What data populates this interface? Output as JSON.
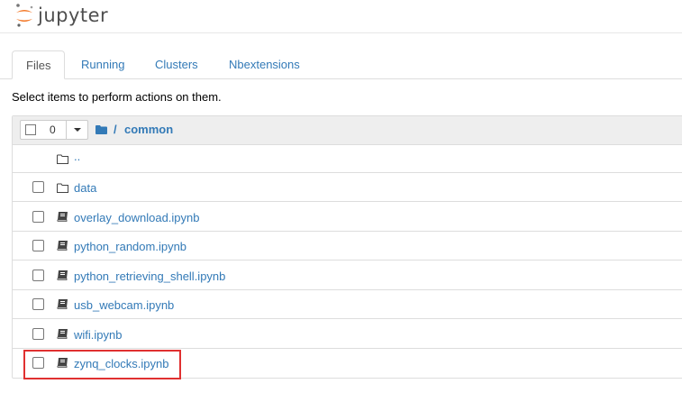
{
  "app": {
    "logo_text": "jupyter",
    "logo_icon": "jupyter-logo-icon",
    "brand_color": "#f37726"
  },
  "tabs": [
    {
      "label": "Files",
      "active": true
    },
    {
      "label": "Running",
      "active": false
    },
    {
      "label": "Clusters",
      "active": false
    },
    {
      "label": "Nbextensions",
      "active": false
    }
  ],
  "hint_text": "Select items to perform actions on them.",
  "list_header": {
    "selected_count": "0",
    "breadcrumb_icon": "folder-icon",
    "breadcrumb_separator": "/",
    "breadcrumb_name": "common"
  },
  "items": [
    {
      "name": "..",
      "type": "folder",
      "icon": "folder-outline-icon",
      "checkbox": false
    },
    {
      "name": "data",
      "type": "folder",
      "icon": "folder-outline-icon",
      "checkbox": true
    },
    {
      "name": "overlay_download.ipynb",
      "type": "notebook",
      "icon": "notebook-icon",
      "checkbox": true
    },
    {
      "name": "python_random.ipynb",
      "type": "notebook",
      "icon": "notebook-icon",
      "checkbox": true
    },
    {
      "name": "python_retrieving_shell.ipynb",
      "type": "notebook",
      "icon": "notebook-icon",
      "checkbox": true
    },
    {
      "name": "usb_webcam.ipynb",
      "type": "notebook",
      "icon": "notebook-icon",
      "checkbox": true
    },
    {
      "name": "wifi.ipynb",
      "type": "notebook",
      "icon": "notebook-icon",
      "checkbox": true
    },
    {
      "name": "zynq_clocks.ipynb",
      "type": "notebook",
      "icon": "notebook-icon",
      "checkbox": true,
      "highlighted": true
    }
  ],
  "colors": {
    "link": "#337ab7",
    "highlight_border": "#e03030",
    "header_bg": "#eeeeee"
  }
}
